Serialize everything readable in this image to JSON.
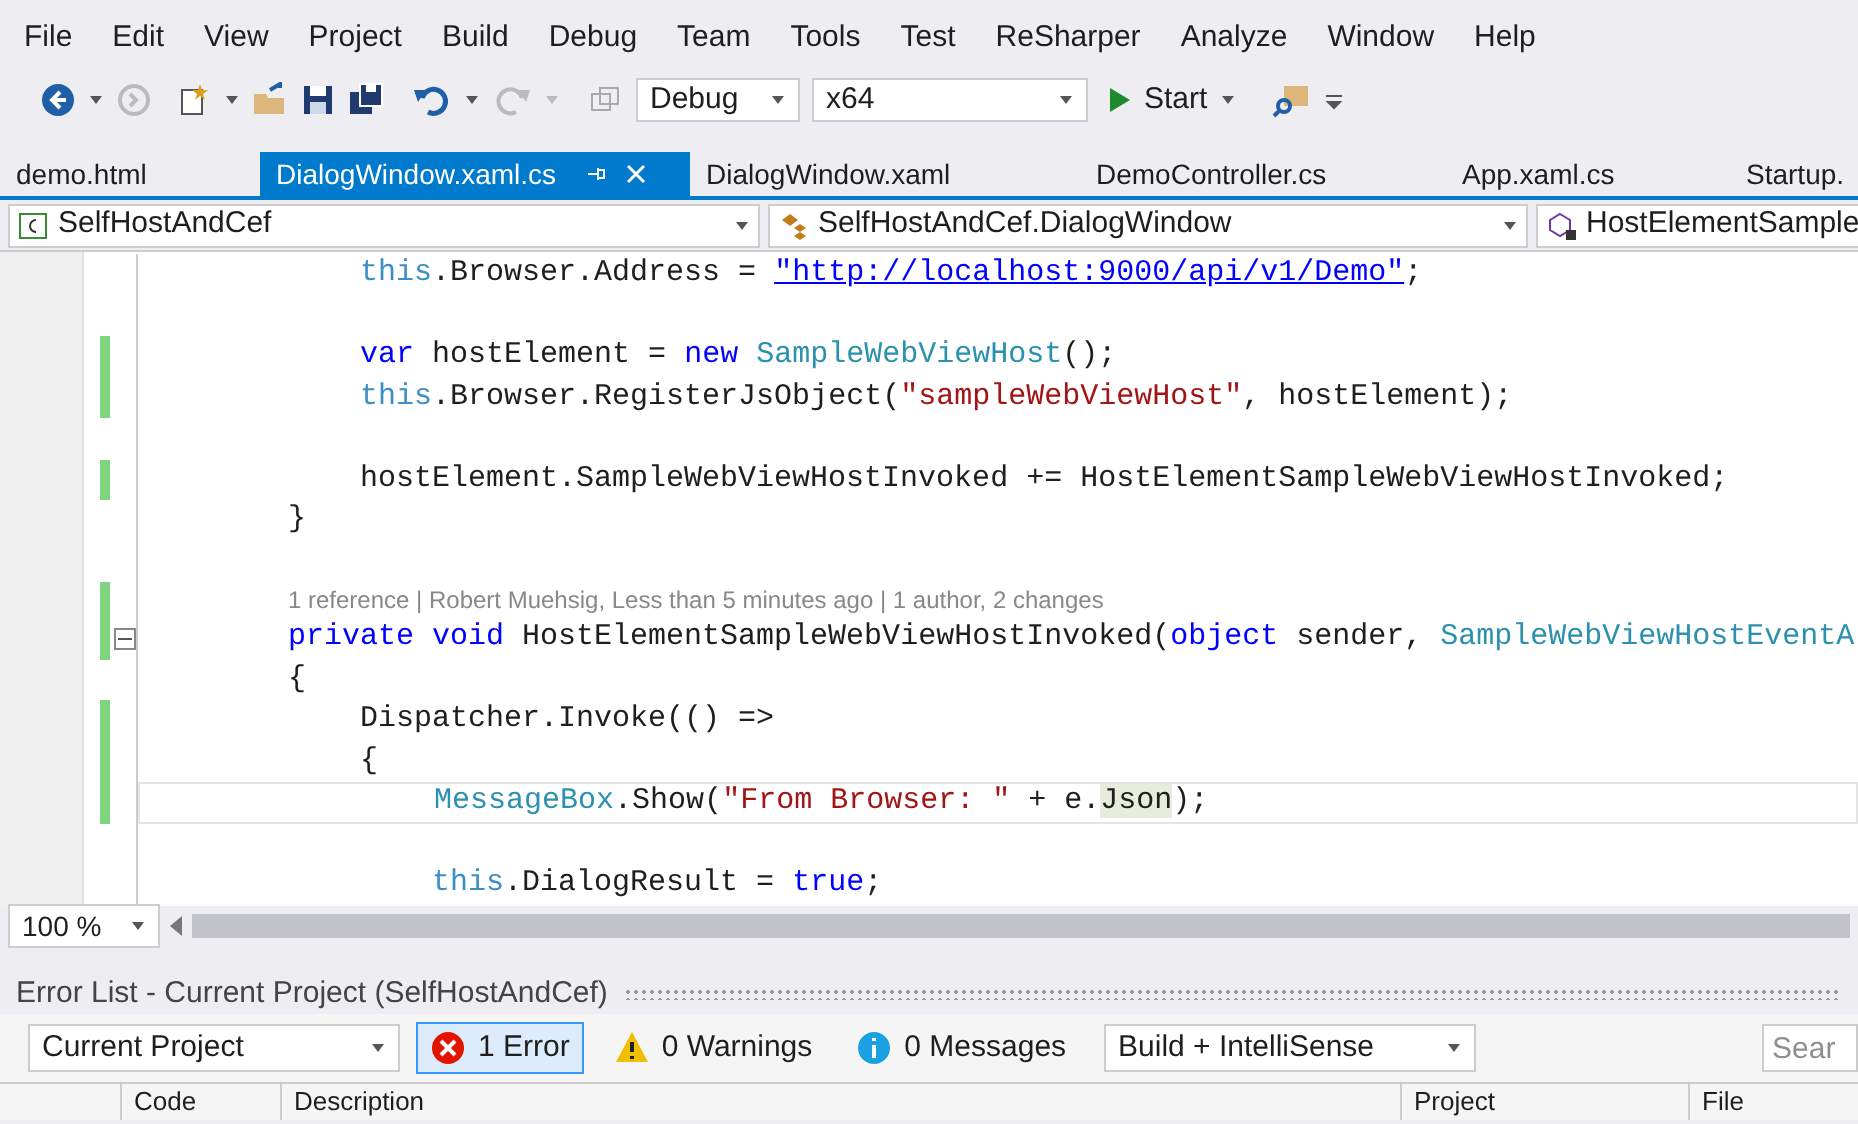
{
  "menu": [
    "File",
    "Edit",
    "View",
    "Project",
    "Build",
    "Debug",
    "Team",
    "Tools",
    "Test",
    "ReSharper",
    "Analyze",
    "Window",
    "Help"
  ],
  "toolbar": {
    "configuration": "Debug",
    "platform": "x64",
    "start": "Start"
  },
  "tabs": [
    {
      "label": "demo.html",
      "selected": false
    },
    {
      "label": "DialogWindow.xaml.cs",
      "selected": true
    },
    {
      "label": "DialogWindow.xaml",
      "selected": false
    },
    {
      "label": "DemoController.cs",
      "selected": false
    },
    {
      "label": "App.xaml.cs",
      "selected": false
    },
    {
      "label": "Startup.",
      "selected": false
    }
  ],
  "navigation": [
    {
      "kind": "project",
      "label": "SelfHostAndCef"
    },
    {
      "kind": "class",
      "label": "SelfHostAndCef.DialogWindow"
    },
    {
      "kind": "member",
      "label": "HostElementSample"
    }
  ],
  "code": [
    {
      "kind": "code",
      "changed": false,
      "segments": [
        {
          "kind": "this",
          "text": "        this"
        },
        {
          "kind": "plain",
          "text": ".Browser.Address = "
        },
        {
          "kind": "url",
          "text": "\"http://localhost:9000/api/v1/Demo\""
        },
        {
          "kind": "plain",
          "text": ";"
        }
      ]
    },
    {
      "kind": "blank",
      "changed": false
    },
    {
      "kind": "code",
      "changed": true,
      "segments": [
        {
          "kind": "keyword",
          "text": "        var"
        },
        {
          "kind": "plain",
          "text": " hostElement = "
        },
        {
          "kind": "keyword",
          "text": "new "
        },
        {
          "kind": "type",
          "text": "SampleWebViewHost"
        },
        {
          "kind": "plain",
          "text": "();"
        }
      ]
    },
    {
      "kind": "code",
      "changed": true,
      "segments": [
        {
          "kind": "this",
          "text": "        this"
        },
        {
          "kind": "plain",
          "text": ".Browser.RegisterJsObject("
        },
        {
          "kind": "string",
          "text": "\"sampleWebViewHost\""
        },
        {
          "kind": "plain",
          "text": ", hostElement);"
        }
      ]
    },
    {
      "kind": "blank",
      "changed": false
    },
    {
      "kind": "code",
      "changed": true,
      "segments": [
        {
          "kind": "plain",
          "text": "        hostElement.SampleWebViewHostInvoked += HostElementSampleWebViewHostInvoked;"
        }
      ]
    },
    {
      "kind": "code",
      "changed": false,
      "segments": [
        {
          "kind": "plain",
          "text": "    }"
        }
      ]
    },
    {
      "kind": "blank",
      "changed": false
    },
    {
      "kind": "codelens",
      "changed": true,
      "text": "1 reference | Robert Muehsig, Less than 5 minutes ago | 1 author, 2 changes"
    },
    {
      "kind": "code",
      "changed": true,
      "collapsible": true,
      "expanded": true,
      "segments": [
        {
          "kind": "keyword",
          "text": "    private void"
        },
        {
          "kind": "plain",
          "text": " HostElementSampleWebViewHostInvoked("
        },
        {
          "kind": "keyword",
          "text": "object"
        },
        {
          "kind": "plain",
          "text": " sender, "
        },
        {
          "kind": "type",
          "text": "SampleWebViewHostEventA"
        }
      ]
    },
    {
      "kind": "code",
      "changed": false,
      "segments": [
        {
          "kind": "plain",
          "text": "    {"
        }
      ]
    },
    {
      "kind": "code",
      "changed": true,
      "segments": [
        {
          "kind": "plain",
          "text": "        Dispatcher.Invoke(() =>"
        }
      ]
    },
    {
      "kind": "code",
      "changed": true,
      "segments": [
        {
          "kind": "plain",
          "text": "        {"
        }
      ]
    },
    {
      "kind": "code",
      "changed": true,
      "current": true,
      "segments": [
        {
          "kind": "type",
          "text": "            MessageBox"
        },
        {
          "kind": "plain",
          "text": ".Show("
        },
        {
          "kind": "string",
          "text": "\"From Browser: \""
        },
        {
          "kind": "plain",
          "text": " + e."
        },
        {
          "kind": "highlight",
          "text": "Json"
        },
        {
          "kind": "plain",
          "text": ");"
        }
      ]
    },
    {
      "kind": "blank",
      "changed": false
    },
    {
      "kind": "code",
      "changed": false,
      "segments": [
        {
          "kind": "this",
          "text": "            this"
        },
        {
          "kind": "plain",
          "text": ".DialogResult = "
        },
        {
          "kind": "keyword",
          "text": "true"
        },
        {
          "kind": "plain",
          "text": ";"
        }
      ]
    }
  ],
  "zoom": "100 %",
  "error_list": {
    "title": "Error List - Current Project (SelfHostAndCef)",
    "scope": "Current Project",
    "filters": [
      {
        "kind": "error",
        "label": "1 Error",
        "selected": true
      },
      {
        "kind": "warning",
        "label": "0 Warnings",
        "selected": false
      },
      {
        "kind": "message",
        "label": "0 Messages",
        "selected": false
      }
    ],
    "source": "Build + IntelliSense",
    "search": {
      "placeholder": "Sear"
    },
    "columns": [
      "Code",
      "Description",
      "Project",
      "File"
    ]
  }
}
